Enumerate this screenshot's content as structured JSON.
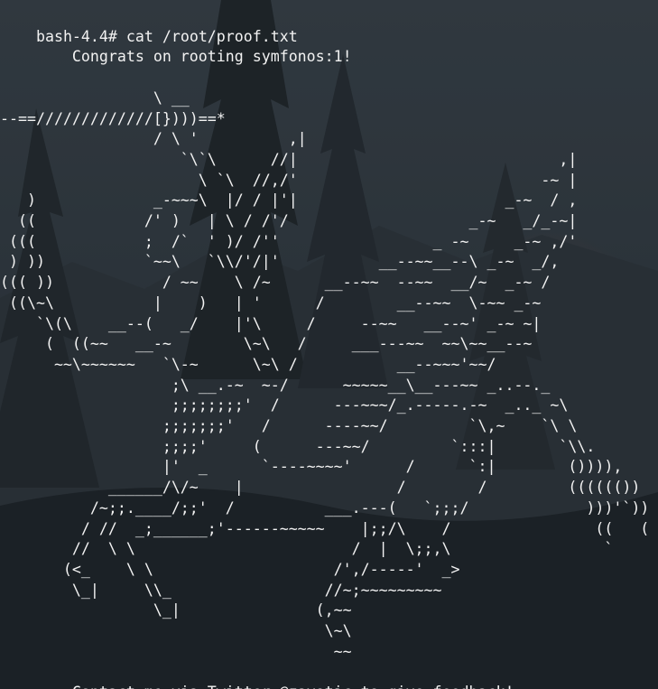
{
  "terminal": {
    "prompt": "bash-4.4#",
    "command": "cat /root/proof.txt",
    "output_lines": [
      "",
      "        Congrats on rooting symfonos:1!",
      "",
      "                 \\ __",
      "--==/////////////[})))==*",
      "                 / \\ '          ,|",
      "                    `\\`\\      //|                             ,|",
      "                      \\ `\\  //,/'                           -~ |",
      "   )             _-~~~\\  |/ / |'|                       _-~  / ,",
      "  ((            /' )   | \\ / /'/                    _-~   _/_-~|",
      " (((            ;  /`  ' )/ /''                 _ -~     _-~ ,/'",
      " ) ))           `~~\\   `\\\\/'/|'           __--~~__--\\ _-~  _/,",
      "((( ))            / ~~    \\ /~      __--~~  --~~  __/~  _-~ /",
      " ((\\~\\           |    )   | '      /        __--~~  \\-~~ _-~",
      "    `\\(\\    __--(   _/    |'\\     /     --~~   __--~' _-~ ~|",
      "     (  ((~~   __-~        \\~\\   /     ___---~~  ~~\\~~__--~",
      "      ~~\\~~~~~~   `\\-~      \\~\\ /           __--~~~'~~/",
      "                   ;\\ __.-~  ~-/      ~~~~~__\\__---~~ _..--._",
      "                   ;;;;;;;;'  /      ---~~~/_.-----.-~  _.._ ~\\",
      "                  ;;;;;;;'   /      ----~~/         `\\,~    `\\ \\",
      "                  ;;;;'     (      ---~~/         `:::|       `\\\\.",
      "                  |'  _      `----~~~~'      /      `:|        ()))),",
      "            ______/\\/~    |                 /        /         (((((())",
      "          /~;;.____/;;'  /          ___.---(   `;;;/             )))'`))",
      "         / //  _;______;'------~~~~~    |;;/\\    /                ((   (",
      "        //  \\ \\                        /  |  \\;;,\\                 `",
      "       (<_    \\ \\                    /',/-----'  _>",
      "        \\_|     \\\\_                 //~;~~~~~~~~~",
      "                 \\_|               (,~~",
      "                                    \\~\\",
      "                                     ~~",
      "",
      "        Contact me via Twitter @zayotic to give feedback!"
    ]
  }
}
